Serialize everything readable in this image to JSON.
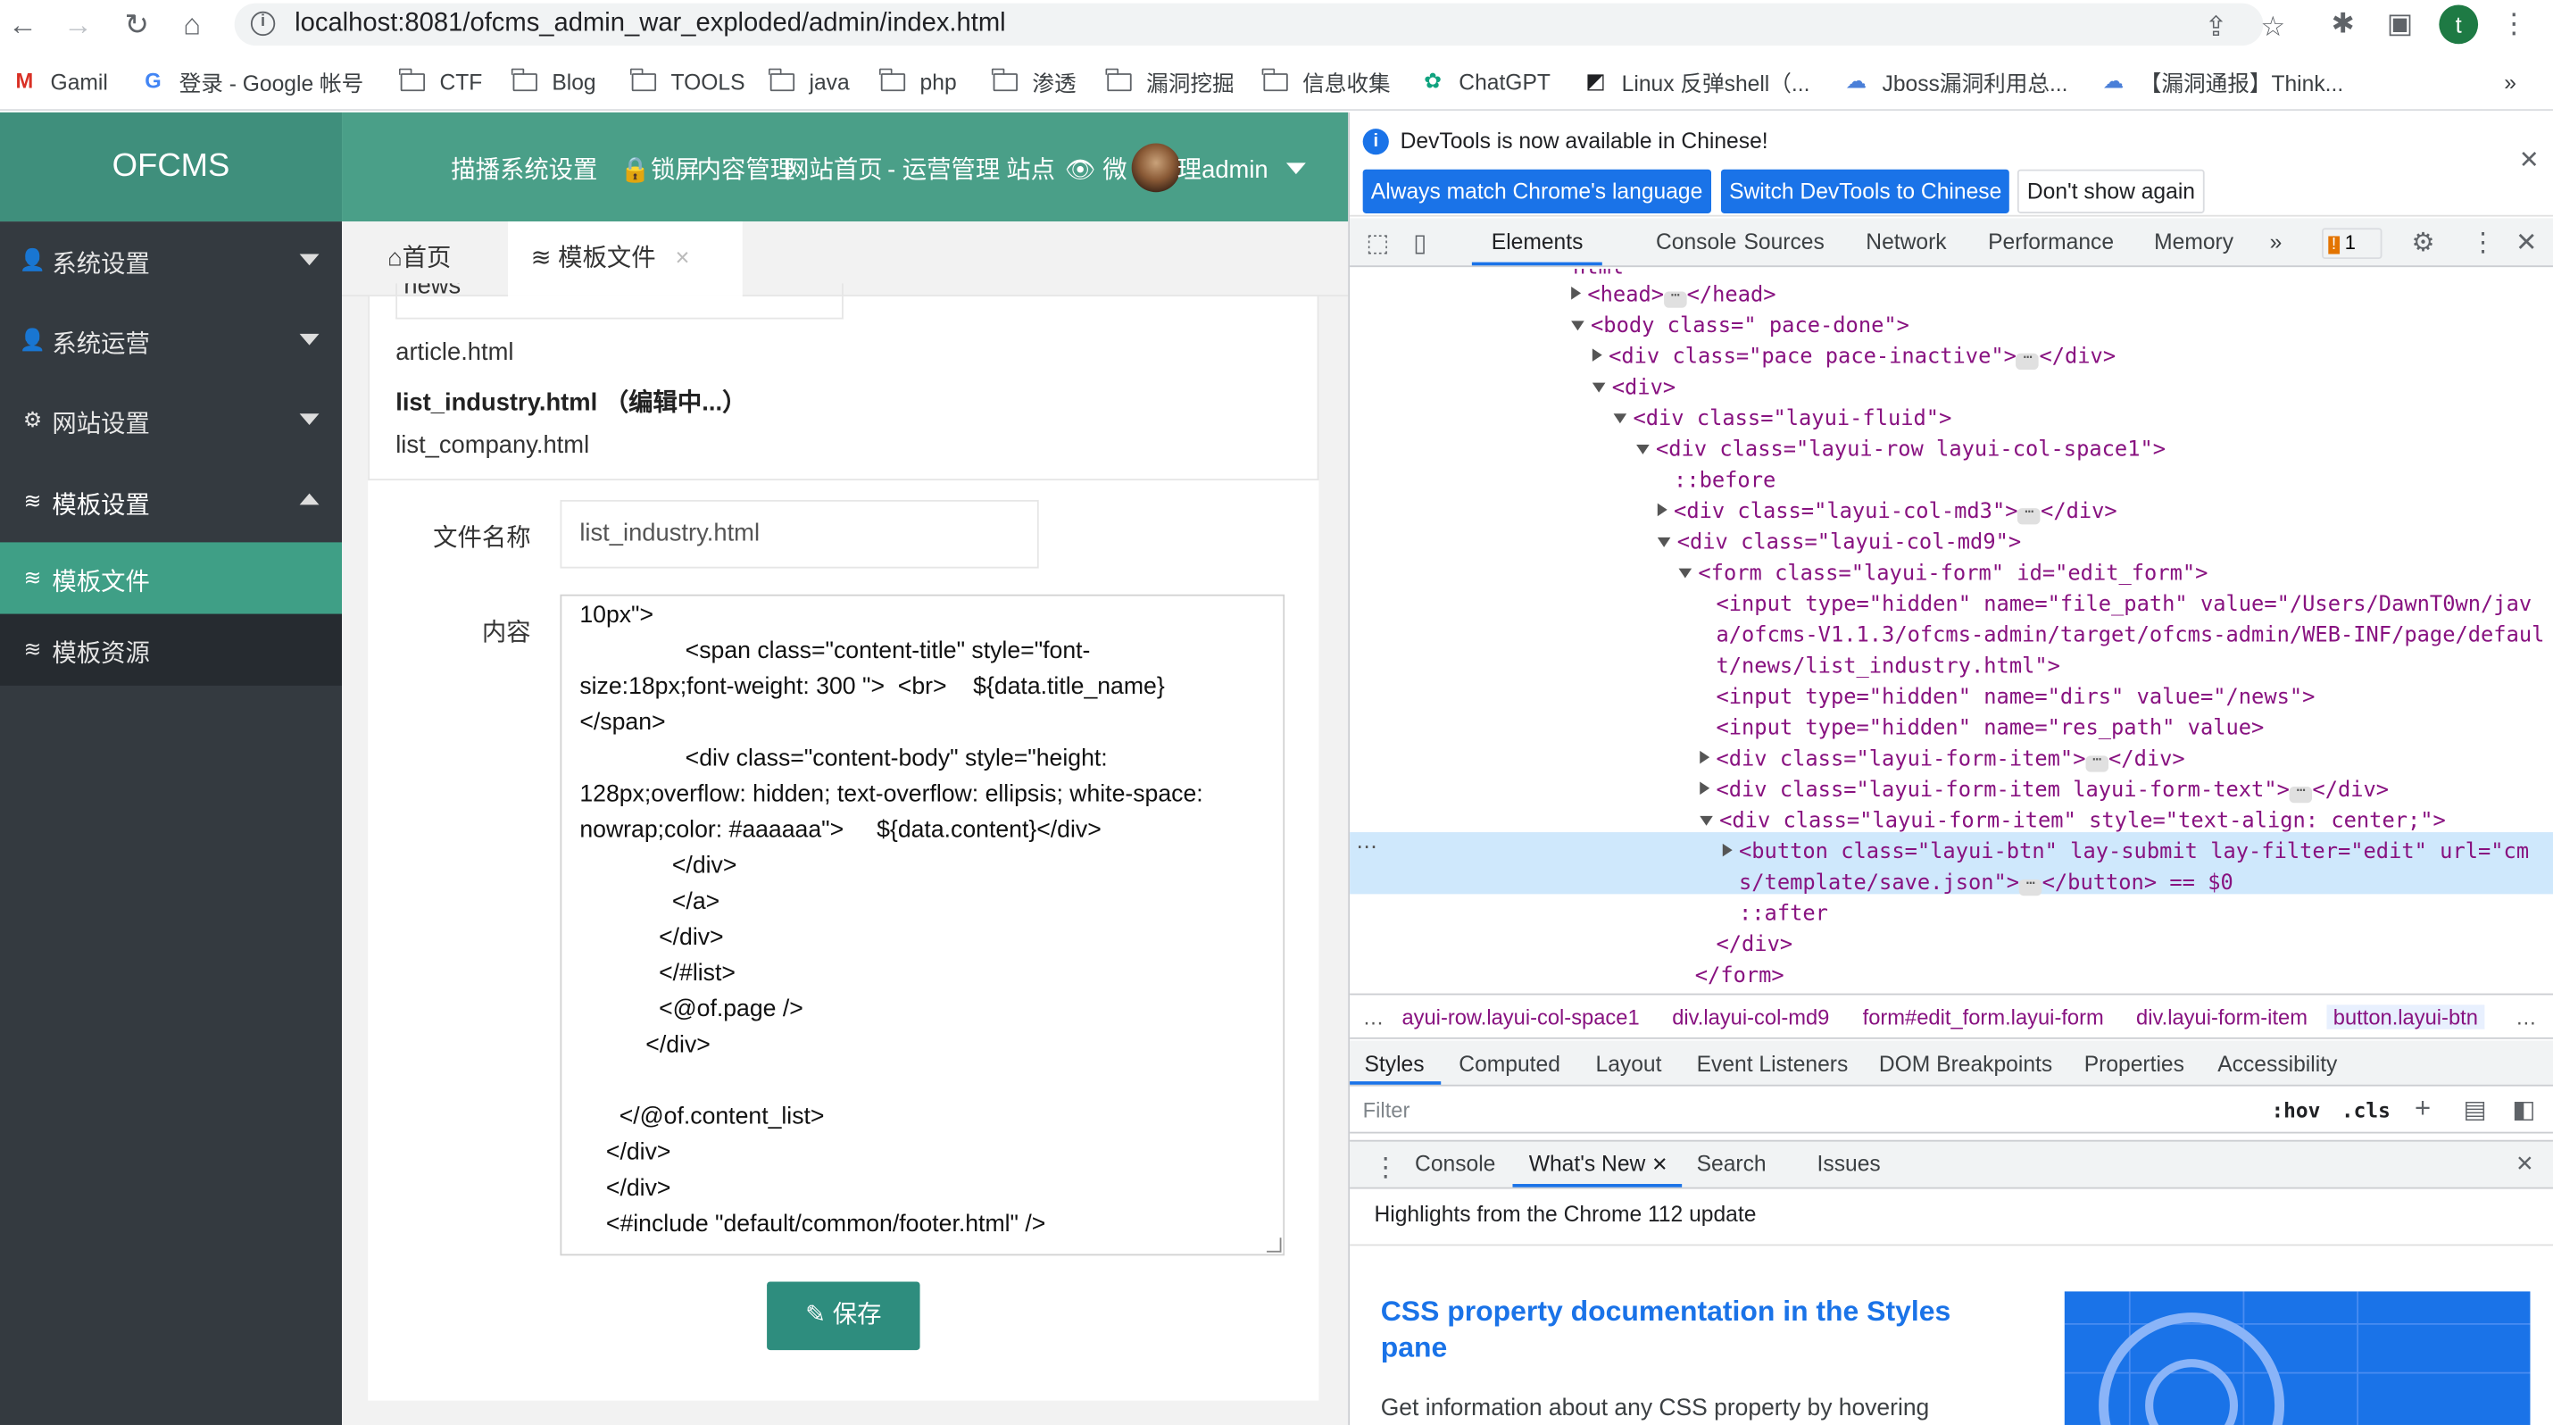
{
  "browser": {
    "url": "localhost:8081/ofcms_admin_war_exploded/admin/index.html",
    "profile_initial": "t",
    "bookmarks": [
      "Gamil",
      "登录 - Google 帐号",
      "CTF",
      "Blog",
      "TOOLS",
      "java",
      "php",
      "渗透",
      "漏洞挖掘",
      "信息收集",
      "ChatGPT",
      "Linux 反弹shell（...",
      "Jboss漏洞利用总...",
      "【漏洞通报】Think..."
    ],
    "more": "»"
  },
  "app": {
    "logo": "OFCMS",
    "topnav": [
      "描播系统设置",
      "🔒锁屏",
      "内容管理",
      "网站首页",
      "- 运营管理",
      "站点",
      "👁 微",
      "理admin"
    ],
    "sidebar": [
      "系统设置",
      "系统运营",
      "网站设置",
      "模板设置"
    ],
    "submenu": [
      "模板文件",
      "模板资源"
    ],
    "tabs": {
      "home": "首页",
      "current": "模板文件",
      "close": "×"
    },
    "files": {
      "partial": "news",
      "article": "article.html",
      "editing": "list_industry.html （编辑中...）",
      "company": "list_company.html"
    },
    "form": {
      "name_label": "文件名称",
      "name_value": "list_industry.html",
      "content_label": "内容",
      "save_label": "保存"
    },
    "code_lines": [
      "10px\">",
      "                <span class=\"content-title\" style=\"font-",
      "size:18px;font-weight: 300 \">  <br>    ${data.title_name}",
      "</span>",
      "                <div class=\"content-body\" style=\"height:",
      "128px;overflow: hidden; text-overflow: ellipsis; white-space:",
      "nowrap;color: #aaaaaa\">     ${data.content}</div>",
      "              </div>",
      "              </a>",
      "            </div>",
      "            </#list>",
      "            <@of.page />",
      "          </div>",
      "",
      "      </@of.content_list>",
      "    </div>",
      "    </div>",
      "    <#include \"default/common/footer.html\" />"
    ]
  },
  "devtools": {
    "notice": "DevTools is now available in Chinese!",
    "btn_match": "Always match Chrome's language",
    "btn_switch": "Switch DevTools to Chinese",
    "btn_dismiss": "Don't show again",
    "tabs": [
      "Elements",
      "Console",
      "Sources",
      "Network",
      "Performance",
      "Memory",
      "»"
    ],
    "issues_count": "1",
    "breadcrumbs": [
      "ayui-row.layui-col-space1",
      "div.layui-col-md9",
      "form#edit_form.layui-form",
      "div.layui-form-item",
      "button.layui-btn"
    ],
    "style_tabs": [
      "Styles",
      "Computed",
      "Layout",
      "Event Listeners",
      "DOM Breakpoints",
      "Properties",
      "Accessibility"
    ],
    "filter_placeholder": "Filter",
    "hov": ":hov",
    "cls": ".cls",
    "drawer_tabs": [
      "Console",
      "What's New",
      "Search",
      "Issues"
    ],
    "highlights": "Highlights from the Chrome 112 update",
    "article_title_1": "CSS property documentation in the Styles",
    "article_title_2": "pane",
    "article_text": "Get information about any CSS property by hovering",
    "dom": {
      "l0": "html",
      "l1": "<head>",
      "l1b": "</head>",
      "l2": "<body class=\"  pace-done\">",
      "l3": "<div class=\"pace  pace-inactive\">",
      "l4": "<div>",
      "l5": "<div class=\"layui-fluid\">",
      "l6": "<div class=\"layui-row layui-col-space1\">",
      "l7": "::before",
      "l8": "<div class=\"layui-col-md3\">",
      "l9": "<div class=\"layui-col-md9\">",
      "l10": "<form class=\"layui-form\" id=\"edit_form\">",
      "l11a": "<input type=\"hidden\" name=\"file_path\" value=\"/Users/DawnT0wn/jav",
      "l11b": "a/ofcms-V1.1.3/ofcms-admin/target/ofcms-admin/WEB-INF/page/defaul",
      "l11c": "t/news/list_industry.html\">",
      "l12": "<input type=\"hidden\" name=\"dirs\" value=\"/news\">",
      "l13": "<input type=\"hidden\" name=\"res_path\" value>",
      "l14": "<div class=\"layui-form-item\">",
      "l15": "<div class=\"layui-form-item layui-form-text\">",
      "l16": "<div class=\"layui-form-item\" style=\"text-align: center;\">",
      "l17a": "<button class=\"layui-btn\" lay-submit lay-filter=\"edit\" url=\"cm",
      "l17b": "s/template/save.json\">",
      "l17c": "</button> == $0",
      "l18": "::after",
      "l19": "</div>",
      "l20": "</form>"
    }
  },
  "colors": {
    "logo": "#3f8f7c",
    "topbar": "#4a9f88",
    "sidebar": "#343a40",
    "active": "#3f9f86",
    "save": "#2e8d7e"
  }
}
